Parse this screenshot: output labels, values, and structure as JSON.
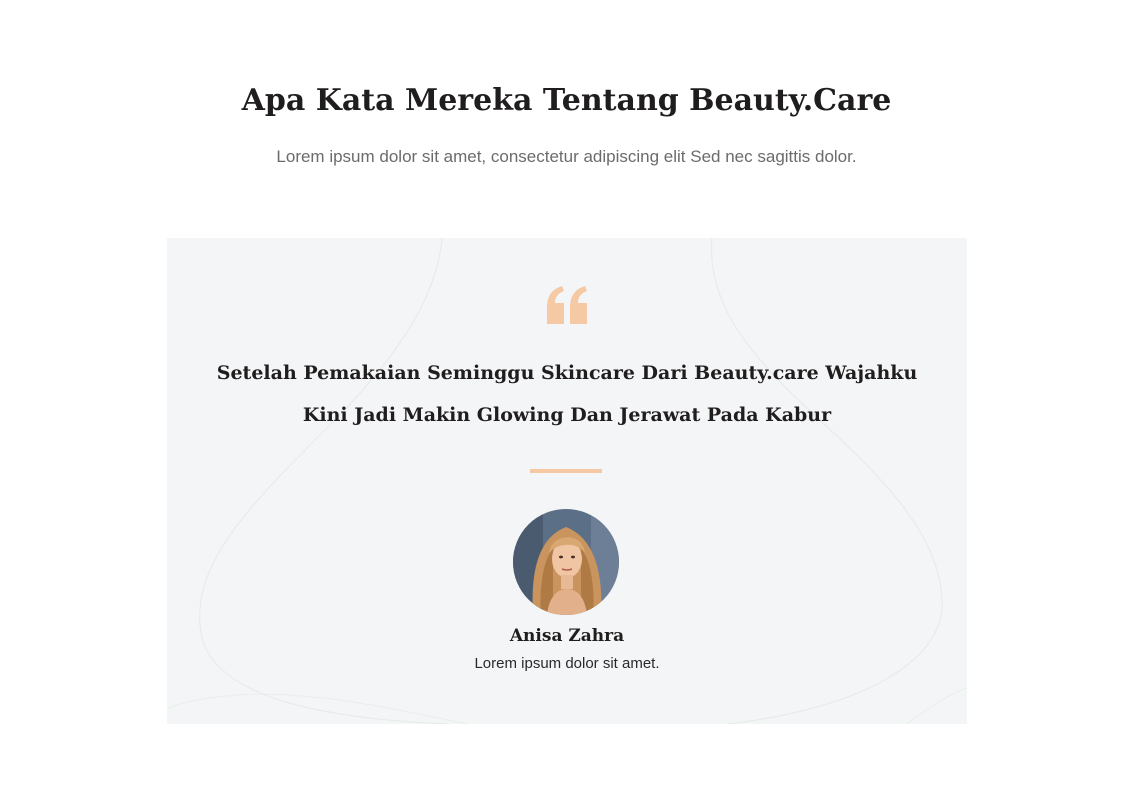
{
  "section": {
    "title": "Apa Kata Mereka Tentang Beauty.Care",
    "subtitle": "Lorem ipsum dolor sit amet, consectetur adipiscing elit Sed nec sagittis dolor."
  },
  "testimonial": {
    "icon": "quote-icon",
    "quote": "Setelah Pemakaian Seminggu Skincare Dari Beauty.care Wajahku Kini Jadi Makin Glowing Dan Jerawat Pada Kabur",
    "author_name": "Anisa Zahra",
    "author_role": "Lorem ipsum dolor sit amet."
  },
  "colors": {
    "accent": "#f5c9a3",
    "card_background": "#f4f5f7",
    "heading": "#1f1d1d",
    "muted_text": "#6b6b6b"
  }
}
